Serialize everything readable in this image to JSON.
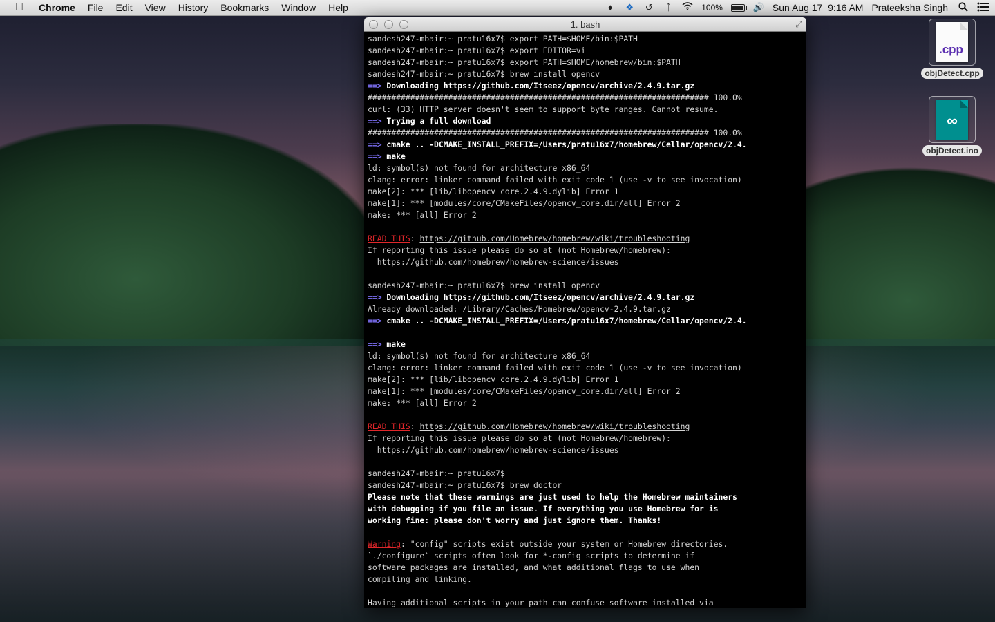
{
  "menubar": {
    "apple_icon": "apple-icon",
    "app_name": "Chrome",
    "menus": [
      "File",
      "Edit",
      "View",
      "History",
      "Bookmarks",
      "Window",
      "Help"
    ],
    "status_icons": [
      "notification-icon",
      "dropbox-icon",
      "time-machine-icon",
      "bluetooth-icon",
      "wifi-icon"
    ],
    "battery_percent": "100%",
    "battery_level": 1.0,
    "volume_icon": "volume-icon",
    "datetime": "Sun Aug 17  9:16 AM",
    "user": "Prateeksha Singh",
    "spotlight_icon": "spotlight-icon",
    "notification_center_icon": "notification-center-icon"
  },
  "terminal": {
    "title": "1. bash",
    "lines": [
      [
        {
          "t": "sandesh247-mbair:~ pratu16x7$ export PATH=$HOME/bin:$PATH"
        }
      ],
      [
        {
          "t": "sandesh247-mbair:~ pratu16x7$ export EDITOR=vi"
        }
      ],
      [
        {
          "t": "sandesh247-mbair:~ pratu16x7$ export PATH=$HOME/homebrew/bin:$PATH"
        }
      ],
      [
        {
          "t": "sandesh247-mbair:~ pratu16x7$ brew install opencv"
        }
      ],
      [
        {
          "t": "==>",
          "c": "arrow"
        },
        {
          "t": " Downloading https://github.com/Itseez/opencv/archive/2.4.9.tar.gz",
          "c": "b"
        }
      ],
      [
        {
          "t": "######################################################################## 100.0%"
        }
      ],
      [
        {
          "t": "curl: (33) HTTP server doesn't seem to support byte ranges. Cannot resume."
        }
      ],
      [
        {
          "t": "==>",
          "c": "arrow"
        },
        {
          "t": " Trying a full download",
          "c": "b"
        }
      ],
      [
        {
          "t": "######################################################################## 100.0%"
        }
      ],
      [
        {
          "t": "==>",
          "c": "arrow"
        },
        {
          "t": " cmake .. -DCMAKE_INSTALL_PREFIX=/Users/pratu16x7/homebrew/Cellar/opencv/2.4.",
          "c": "b"
        }
      ],
      [
        {
          "t": "==>",
          "c": "arrow"
        },
        {
          "t": " make",
          "c": "b"
        }
      ],
      [
        {
          "t": "ld: symbol(s) not found for architecture x86_64"
        }
      ],
      [
        {
          "t": "clang: error: linker command failed with exit code 1 (use -v to see invocation)"
        }
      ],
      [
        {
          "t": "make[2]: *** [lib/libopencv_core.2.4.9.dylib] Error 1"
        }
      ],
      [
        {
          "t": "make[1]: *** [modules/core/CMakeFiles/opencv_core.dir/all] Error 2"
        }
      ],
      [
        {
          "t": "make: *** [all] Error 2"
        }
      ],
      [],
      [
        {
          "t": "READ THIS",
          "c": "red"
        },
        {
          "t": ": "
        },
        {
          "t": "https://github.com/Homebrew/homebrew/wiki/troubleshooting",
          "c": "url"
        }
      ],
      [
        {
          "t": "If reporting this issue please do so at (not Homebrew/homebrew):"
        }
      ],
      [
        {
          "t": "  https://github.com/homebrew/homebrew-science/issues"
        }
      ],
      [],
      [
        {
          "t": "sandesh247-mbair:~ pratu16x7$ brew install opencv"
        }
      ],
      [
        {
          "t": "==>",
          "c": "arrow"
        },
        {
          "t": " Downloading https://github.com/Itseez/opencv/archive/2.4.9.tar.gz",
          "c": "b"
        }
      ],
      [
        {
          "t": "Already downloaded: /Library/Caches/Homebrew/opencv-2.4.9.tar.gz"
        }
      ],
      [
        {
          "t": "==>",
          "c": "arrow"
        },
        {
          "t": " cmake .. -DCMAKE_INSTALL_PREFIX=/Users/pratu16x7/homebrew/Cellar/opencv/2.4.",
          "c": "b"
        }
      ],
      [],
      [
        {
          "t": "==>",
          "c": "arrow"
        },
        {
          "t": " make",
          "c": "b"
        }
      ],
      [
        {
          "t": "ld: symbol(s) not found for architecture x86_64"
        }
      ],
      [
        {
          "t": "clang: error: linker command failed with exit code 1 (use -v to see invocation)"
        }
      ],
      [
        {
          "t": "make[2]: *** [lib/libopencv_core.2.4.9.dylib] Error 1"
        }
      ],
      [
        {
          "t": "make[1]: *** [modules/core/CMakeFiles/opencv_core.dir/all] Error 2"
        }
      ],
      [
        {
          "t": "make: *** [all] Error 2"
        }
      ],
      [],
      [
        {
          "t": "READ THIS",
          "c": "red"
        },
        {
          "t": ": "
        },
        {
          "t": "https://github.com/Homebrew/homebrew/wiki/troubleshooting",
          "c": "url"
        }
      ],
      [
        {
          "t": "If reporting this issue please do so at (not Homebrew/homebrew):"
        }
      ],
      [
        {
          "t": "  https://github.com/homebrew/homebrew-science/issues"
        }
      ],
      [],
      [
        {
          "t": "sandesh247-mbair:~ pratu16x7$"
        }
      ],
      [
        {
          "t": "sandesh247-mbair:~ pratu16x7$ brew doctor"
        }
      ],
      [
        {
          "t": "Please note that these warnings are just used to help the Homebrew maintainers",
          "c": "b"
        }
      ],
      [
        {
          "t": "with debugging if you file an issue. If everything you use Homebrew for is",
          "c": "b"
        }
      ],
      [
        {
          "t": "working fine: please don't worry and just ignore them. Thanks!",
          "c": "b"
        }
      ],
      [],
      [
        {
          "t": "Warning",
          "c": "red"
        },
        {
          "t": ": \"config\" scripts exist outside your system or Homebrew directories."
        }
      ],
      [
        {
          "t": "`./configure` scripts often look for *-config scripts to determine if"
        }
      ],
      [
        {
          "t": "software packages are installed, and what additional flags to use when"
        }
      ],
      [
        {
          "t": "compiling and linking."
        }
      ],
      [],
      [
        {
          "t": "Having additional scripts in your path can confuse software installed via"
        }
      ]
    ]
  },
  "desktop": {
    "icons": [
      {
        "label": "objDetect.cpp",
        "ext": ".cpp",
        "icon": "cpp-file-icon"
      },
      {
        "label": "objDetect.ino",
        "ext": "∞",
        "icon": "arduino-file-icon"
      }
    ]
  }
}
